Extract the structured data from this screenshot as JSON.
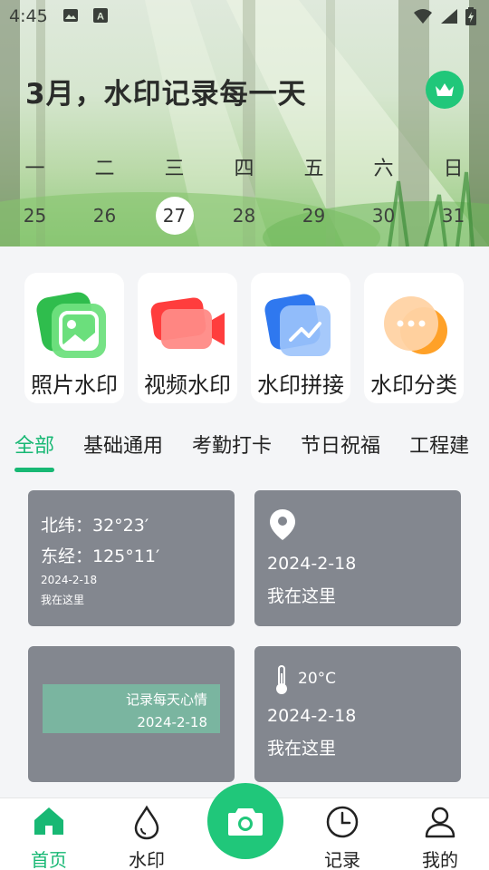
{
  "status_bar": {
    "time": "4:45",
    "icons": [
      "image-icon",
      "font-icon",
      "wifi-icon",
      "signal-icon",
      "battery-charging-icon"
    ]
  },
  "header": {
    "title": "3月，水印记录每一天",
    "crown_icon": "crown-icon",
    "weekdays": [
      "一",
      "二",
      "三",
      "四",
      "五",
      "六",
      "日"
    ],
    "dates": [
      "25",
      "26",
      "27",
      "28",
      "29",
      "30",
      "31"
    ],
    "today": "27"
  },
  "features": [
    {
      "label": "照片水印",
      "icon": "photo-watermark-icon",
      "color": "#3ed15a"
    },
    {
      "label": "视频水印",
      "icon": "video-watermark-icon",
      "color": "#ff5a4e"
    },
    {
      "label": "水印拼接",
      "icon": "watermark-stitch-icon",
      "color": "#3f86f3"
    },
    {
      "label": "水印分类",
      "icon": "watermark-category-icon",
      "color": "#ffa23a"
    }
  ],
  "tabs": [
    "全部",
    "基础通用",
    "考勤打卡",
    "节日祝福",
    "工程建"
  ],
  "active_tab": "全部",
  "templates": {
    "t1": {
      "lat": "北纬：32°23′",
      "lng": "东经：125°11′",
      "date": "2024-2-18",
      "place": "我在这里"
    },
    "t2": {
      "date": "2024-2-18",
      "place": "我在这里"
    },
    "t3": {
      "line1": "记录每天心情",
      "line2": "2024-2-18"
    },
    "t4": {
      "temp": "20°C",
      "date": "2024-2-18",
      "place": "我在这里"
    }
  },
  "bottom_nav": {
    "home": "首页",
    "watermark": "水印",
    "records": "记录",
    "mine": "我的"
  },
  "colors": {
    "accent": "#18b874",
    "template_bg": "#83878f"
  }
}
